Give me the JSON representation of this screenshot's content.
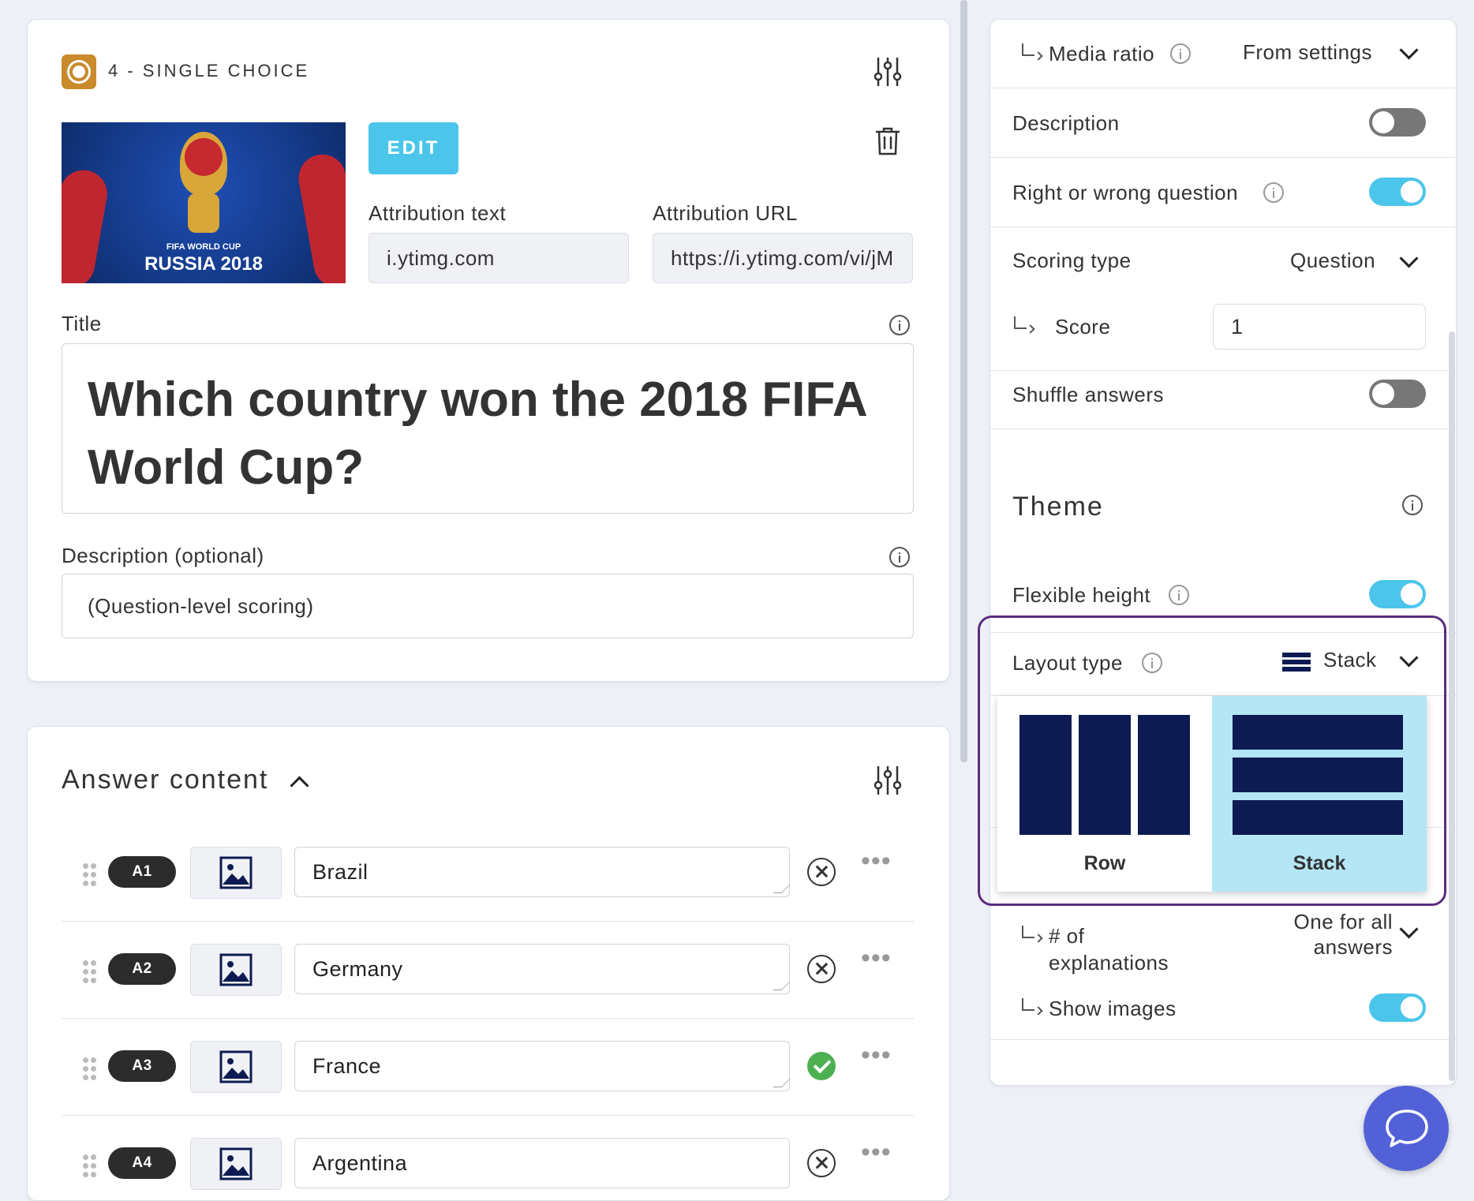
{
  "question": {
    "type_label": "4 - SINGLE CHOICE",
    "edit_label": "EDIT",
    "media_caption_top": "FIFA WORLD CUP",
    "media_caption_bottom": "RUSSIA 2018",
    "attribution_text_label": "Attribution text",
    "attribution_text_value": "i.ytimg.com",
    "attribution_url_label": "Attribution URL",
    "attribution_url_value": "https://i.ytimg.com/vi/jM",
    "title_label": "Title",
    "title_value": "Which country won the 2018 FIFA World Cup?",
    "description_label": "Description (optional)",
    "description_value": "(Question-level scoring)"
  },
  "answers": {
    "heading": "Answer content",
    "items": [
      {
        "badge": "A1",
        "text": "Brazil",
        "correct": false
      },
      {
        "badge": "A2",
        "text": "Germany",
        "correct": false
      },
      {
        "badge": "A3",
        "text": "France",
        "correct": true
      },
      {
        "badge": "A4",
        "text": "Argentina",
        "correct": false
      }
    ]
  },
  "settings": {
    "media_ratio_label": "Media ratio",
    "media_ratio_value": "From settings",
    "description_label": "Description",
    "description_on": false,
    "right_wrong_label": "Right or wrong question",
    "right_wrong_on": true,
    "scoring_type_label": "Scoring type",
    "scoring_type_value": "Question",
    "score_label": "Score",
    "score_value": "1",
    "shuffle_label": "Shuffle answers",
    "shuffle_on": false,
    "theme_heading": "Theme",
    "flexible_height_label": "Flexible height",
    "flexible_height_on": true,
    "layout_type_label": "Layout type",
    "layout_type_value": "Stack",
    "layout_options": [
      {
        "label": "Row",
        "selected": false
      },
      {
        "label": "Stack",
        "selected": true
      }
    ],
    "explanations_label_1": "# of",
    "explanations_label_2": "explanations",
    "explanations_value_1": "One for all",
    "explanations_value_2": "answers",
    "show_images_label": "Show images",
    "show_images_on": true
  },
  "colors": {
    "accent": "#4cc5ea",
    "navy": "#0d1b52",
    "highlight_border": "#5b2d7e",
    "chat_button": "#5361d8",
    "correct": "#4cb050"
  },
  "icons": [
    "single-choice-icon",
    "sliders-icon",
    "trash-icon",
    "info-icon",
    "chevron-down-icon",
    "chevron-up-icon",
    "drag-handle-icon",
    "image-icon",
    "remove-answer-icon",
    "correct-answer-icon",
    "more-options-icon",
    "chat-icon",
    "stack-layout-icon",
    "indent-arrow-icon"
  ]
}
